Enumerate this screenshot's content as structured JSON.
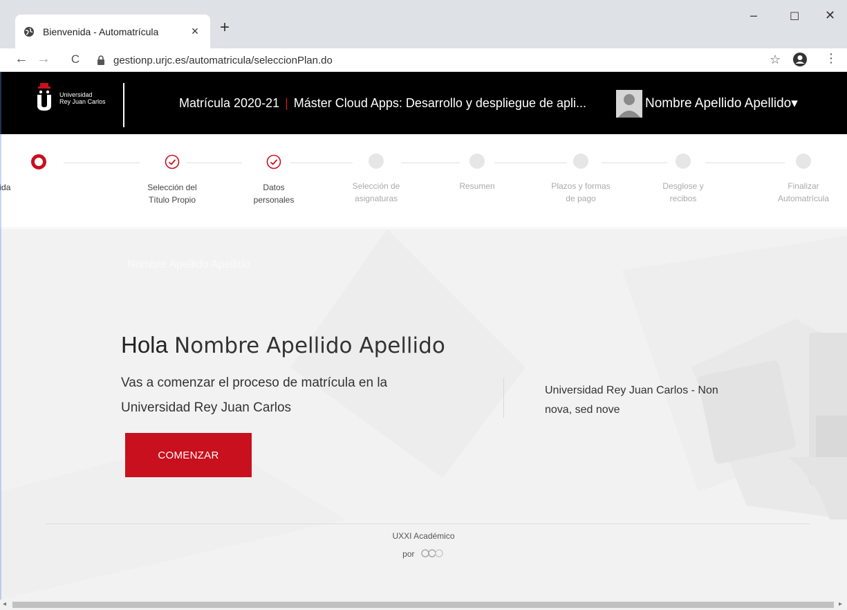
{
  "browser": {
    "tab_title": "Bienvenida - Automatrícula",
    "tab_close": "×",
    "new_tab": "+",
    "minimize": "–",
    "maximize": "☐",
    "close": "✕",
    "url": "gestionp.urjc.es/automatricula/seleccionPlan.do",
    "back": "←",
    "forward": "→",
    "reload": "C",
    "star": "☆",
    "menu": "⋮"
  },
  "header": {
    "logo_line1": "Universidad",
    "logo_line2": "Rey Juan Carlos",
    "title_left": "Matrícula 2020-21",
    "title_sep": "|",
    "title_right": "Máster Cloud Apps: Desarrollo y despliegue de apli...",
    "user_name": "Nombre Apellido Apellido",
    "user_caret": "▾"
  },
  "steps": [
    {
      "line1": "Bienvenida",
      "line2": "",
      "state": "current"
    },
    {
      "line1": "Selección del",
      "line2": "Título Propio",
      "state": "done"
    },
    {
      "line1": "Datos",
      "line2": "personales",
      "state": "done"
    },
    {
      "line1": "Selección de",
      "line2": "asignaturas",
      "state": "pending"
    },
    {
      "line1": "Resumen",
      "line2": "",
      "state": "pending"
    },
    {
      "line1": "Plazos y formas",
      "line2": "de pago",
      "state": "pending"
    },
    {
      "line1": "Desglose y",
      "line2": "recibos",
      "state": "pending"
    },
    {
      "line1": "Finalizar",
      "line2": "Automatrícula",
      "state": "pending"
    }
  ],
  "main": {
    "ghost_name": "Nombre Apellido Apellido",
    "hola": "Hola",
    "name": "Nombre Apellido Apellido",
    "intro_line1": "Vas a comenzar el proceso de matrícula en la",
    "intro_line2": "Universidad Rey Juan Carlos",
    "motto_line1": "Universidad Rey Juan Carlos - Non",
    "motto_line2": "nova, sed nove",
    "button": "COMENZAR",
    "footer_line1": "UXXI Académico",
    "footer_line2": "por"
  },
  "colors": {
    "brand_red": "#c8101e",
    "header_bg": "#000000",
    "content_bg": "#f2f2f2"
  },
  "icons": {
    "favicon": "globe-icon",
    "lock": "lock-icon",
    "account": "account-circle-icon",
    "step_done": "check-circle-icon",
    "step_current": "ring-icon"
  }
}
